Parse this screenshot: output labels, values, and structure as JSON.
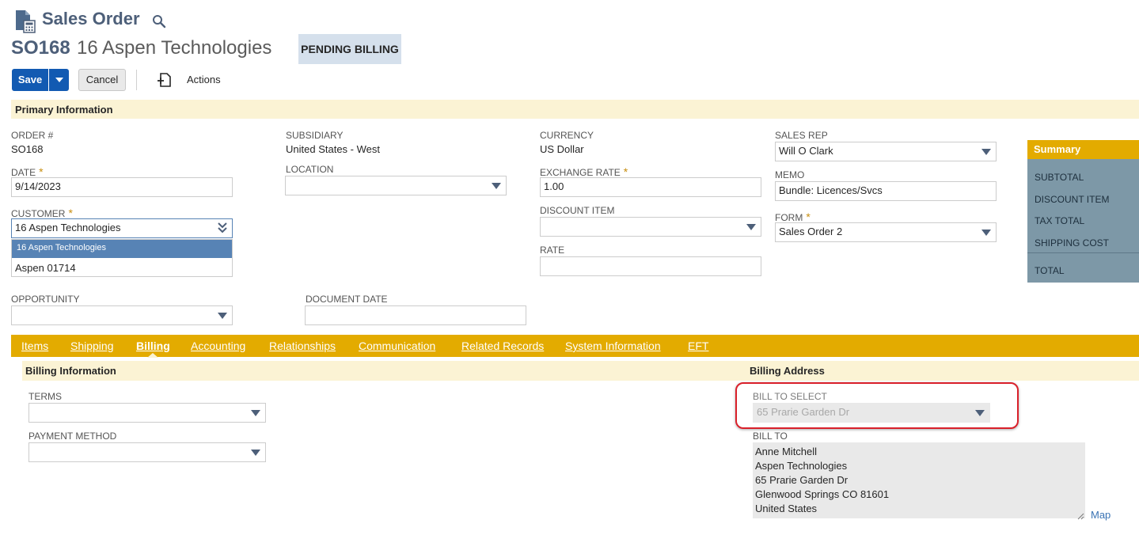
{
  "header": {
    "title": "Sales Order",
    "record_number": "SO168",
    "record_name": "16 Aspen Technologies",
    "status": "PENDING BILLING"
  },
  "toolbar": {
    "save_label": "Save",
    "cancel_label": "Cancel",
    "actions_label": "Actions"
  },
  "primary": {
    "section_label": "Primary Information",
    "order_label": "ORDER #",
    "order_value": "SO168",
    "date_label": "DATE",
    "date_value": "9/14/2023",
    "customer_label": "CUSTOMER",
    "customer_value": "16 Aspen Technologies",
    "customer_options": [
      "16 Aspen Technologies",
      "Aspen 01714"
    ],
    "opportunity_label": "OPPORTUNITY",
    "opportunity_value": "",
    "subsidiary_label": "SUBSIDIARY",
    "subsidiary_value": "United States - West",
    "location_label": "LOCATION",
    "location_value": "",
    "document_date_label": "DOCUMENT DATE",
    "document_date_value": "",
    "currency_label": "CURRENCY",
    "currency_value": "US Dollar",
    "exchange_rate_label": "EXCHANGE RATE",
    "exchange_rate_value": "1.00",
    "discount_item_label": "DISCOUNT ITEM",
    "discount_item_value": "",
    "rate_label": "RATE",
    "rate_value": "",
    "sales_rep_label": "SALES REP",
    "sales_rep_value": "Will O Clark",
    "memo_label": "MEMO",
    "memo_value": "Bundle: Licences/Svcs",
    "form_label": "FORM",
    "form_value": "Sales Order 2",
    "required_marker": "*"
  },
  "summary": {
    "title": "Summary",
    "rows": [
      "SUBTOTAL",
      "DISCOUNT ITEM",
      "TAX TOTAL",
      "SHIPPING COST",
      "TOTAL"
    ]
  },
  "tabs": [
    {
      "label": "Items",
      "active": false
    },
    {
      "label": "Shipping",
      "active": false
    },
    {
      "label": "Billing",
      "active": true
    },
    {
      "label": "Accounting",
      "active": false
    },
    {
      "label": "Relationships",
      "active": false
    },
    {
      "label": "Communication",
      "active": false
    },
    {
      "label": "Related Records",
      "active": false
    },
    {
      "label": "System Information",
      "active": false
    },
    {
      "label": "EFT",
      "active": false
    }
  ],
  "billing": {
    "info_label": "Billing Information",
    "address_label": "Billing Address",
    "terms_label": "TERMS",
    "terms_value": "",
    "payment_method_label": "PAYMENT METHOD",
    "payment_method_value": "",
    "bill_to_select_label": "BILL TO SELECT",
    "bill_to_select_value": "65 Prarie Garden Dr",
    "bill_to_label": "BILL TO",
    "bill_to_lines": [
      "Anne Mitchell",
      "Aspen Technologies",
      "65 Prarie Garden Dr",
      "Glenwood Springs CO 81601",
      "United States"
    ],
    "map_label": "Map"
  },
  "colors": {
    "brand_blue": "#125ab2",
    "header_text": "#4d5f79",
    "tab_gold": "#e3ab00",
    "section_cream": "#fbf3d4",
    "summary_slate": "#7d98a7",
    "highlight_red": "#d9202a"
  },
  "icons": {
    "title": "sales-order-document-icon",
    "search": "search-icon",
    "save_menu": "caret-down-icon",
    "actions": "add-document-icon",
    "select": "caret-down-icon",
    "combobox": "double-chevron-down-icon"
  }
}
